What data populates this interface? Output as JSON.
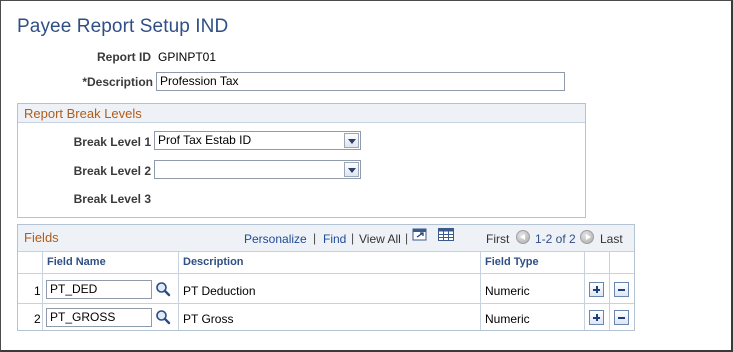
{
  "page": {
    "title": "Payee Report Setup IND"
  },
  "header": {
    "report_id_label": "Report ID",
    "report_id_value": "GPINPT01",
    "description_label": "*Description",
    "description_value": "Profession Tax"
  },
  "break_levels": {
    "title": "Report Break Levels",
    "level1_label": "Break Level 1",
    "level1_value": "Prof Tax Estab ID",
    "level2_label": "Break Level 2",
    "level2_value": "",
    "level3_label": "Break Level 3"
  },
  "fields_grid": {
    "title": "Fields",
    "personalize": "Personalize",
    "sep1": "|",
    "find": "Find",
    "sep2": "|",
    "view_all": "View All",
    "sep3": "|",
    "first": "First",
    "range": "1-2 of 2",
    "last": "Last",
    "columns": {
      "field_name": "Field Name",
      "description": "Description",
      "field_type": "Field Type"
    },
    "rows": [
      {
        "num": "1",
        "field_name": "PT_DED",
        "description": "PT Deduction",
        "field_type": "Numeric"
      },
      {
        "num": "2",
        "field_name": "PT_GROSS",
        "description": "PT Gross",
        "field_type": "Numeric"
      }
    ]
  },
  "colors": {
    "title": "#2f4f86",
    "group_title": "#b05c1a",
    "link": "#1f4a96"
  },
  "icons": {
    "lookup": "magnifier-icon",
    "download": "download-icon",
    "chart": "grid-view-icon",
    "add_row": "plus-icon",
    "delete_row": "minus-icon"
  }
}
